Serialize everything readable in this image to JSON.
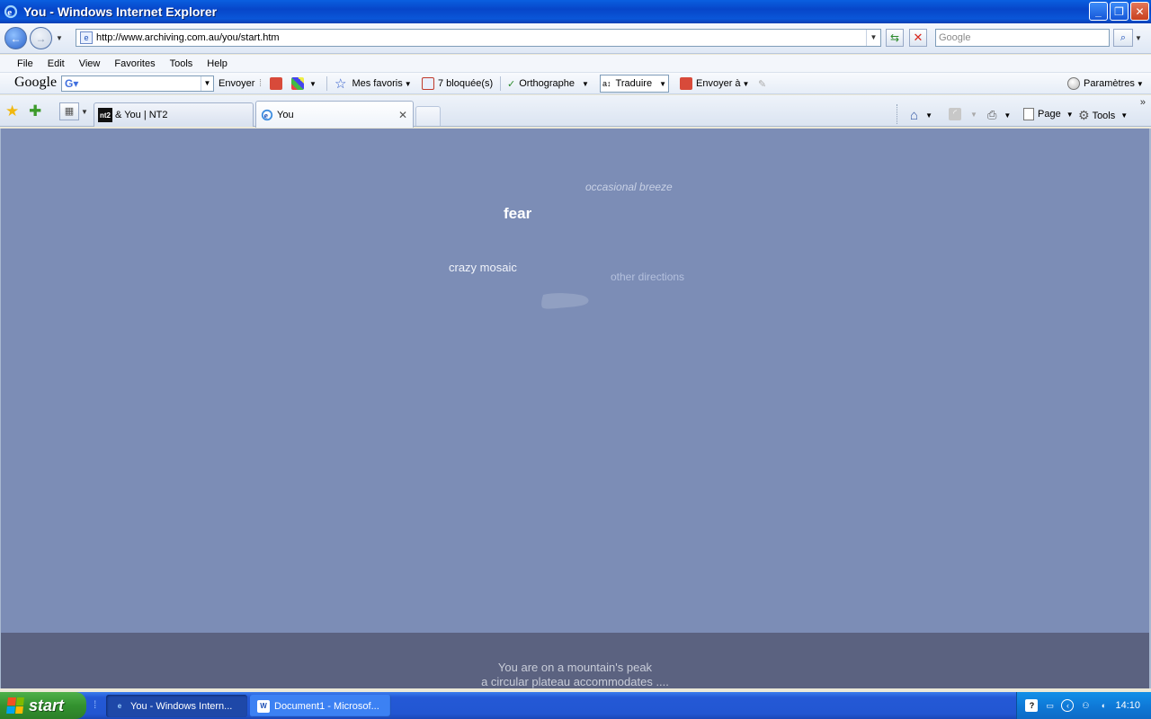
{
  "window": {
    "title": "You - Windows Internet Explorer",
    "minimize_label": "_",
    "maximize_label": "❐",
    "close_label": "✕"
  },
  "address_bar": {
    "url": "http://www.archiving.com.au/you/start.htm",
    "search_placeholder": "Google"
  },
  "menu": {
    "items": [
      "File",
      "Edit",
      "View",
      "Favorites",
      "Tools",
      "Help"
    ]
  },
  "google_toolbar": {
    "logo": "Google",
    "send_label": "Envoyer",
    "favorites_label": "Mes favoris",
    "blocked_label": "7 bloquée(s)",
    "spelling_label": "Orthographe",
    "translate_label": "Traduire",
    "send_to_label": "Envoyer à",
    "settings_label": "Paramètres"
  },
  "tabs": {
    "items": [
      {
        "label": "& You | NT2",
        "favicon": "nt2",
        "active": false
      },
      {
        "label": "You",
        "active": true
      }
    ],
    "commands": {
      "page_label": "Page",
      "tools_label": "Tools"
    }
  },
  "page": {
    "phrases": {
      "breeze": "occasional breeze",
      "fear": "fear",
      "mosaic": "crazy mosaic",
      "directions": "other directions"
    },
    "footer_line1": "You are on a mountain's peak",
    "footer_line2": "a circular plateau accommodates ....",
    "colors": {
      "background": "#7c8db6",
      "footer": "#5b6280"
    }
  },
  "taskbar": {
    "start_label": "start",
    "buttons": [
      {
        "label": "You - Windows Intern...",
        "icon": "ie-icon",
        "active": true
      },
      {
        "label": "Document1 - Microsof...",
        "icon": "word-icon",
        "active": false
      }
    ],
    "clock": "14:10"
  }
}
